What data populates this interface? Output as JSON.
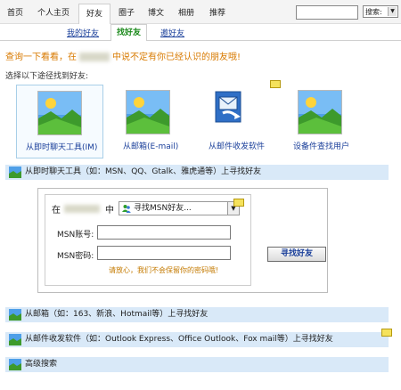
{
  "nav": {
    "items": [
      "首页",
      "个人主页",
      "好友",
      "圈子",
      "博文",
      "相册",
      "推荐"
    ],
    "search_select": "搜索:"
  },
  "subtabs": [
    "我的好友",
    "找好友",
    "邀好友"
  ],
  "intro": {
    "prefix": "查询一下看看，在",
    "suffix": "中说不定有你已经认识的朋友哦!"
  },
  "choose_label": "选择以下途径找到好友:",
  "tiles": [
    {
      "label": "从即时聊天工具(IM)",
      "icon": "image-placeholder-icon"
    },
    {
      "label": "从邮箱(E-mail)",
      "icon": "image-placeholder-icon"
    },
    {
      "label": "从邮件收发软件",
      "icon": "mail-client-icon"
    },
    {
      "label": "设备件查找用户",
      "icon": "image-placeholder-icon"
    }
  ],
  "sections": {
    "im": "从即时聊天工具（如：MSN、QQ、Gtalk、雅虎通等）上寻找好友",
    "email": "从邮箱（如：163、新浪、Hotmail等）上寻找好友",
    "mail_client": "从邮件收发软件（如：Outlook Express、Office Outlook、Fox mail等）上寻找好友",
    "advanced": "高级搜索"
  },
  "form": {
    "in_label": "在",
    "zhong": "中",
    "select_value": "寻找MSN好友...",
    "account_label": "MSN账号:",
    "password_label": "MSN密码:",
    "find_button": "寻找好友",
    "privacy_note": "请放心，我们不会保留你的密码哦!"
  },
  "colors": {
    "section_bar": "#d9e9f8",
    "link": "#1a3f9a",
    "intro": "#d87a00",
    "active_tab": "#1c8a1c"
  }
}
